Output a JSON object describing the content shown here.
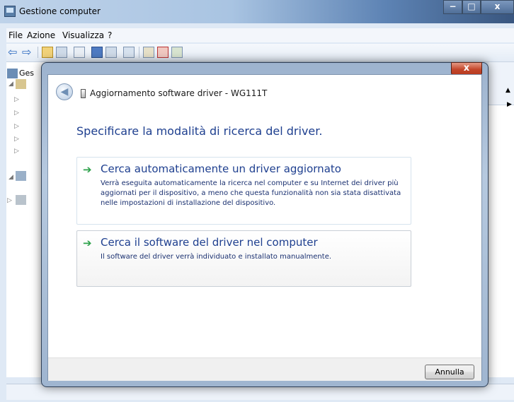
{
  "background_window": {
    "title": "Gestione computer",
    "title_icon": "computer-management-icon",
    "controls": {
      "minimize": "−",
      "maximize": "□",
      "close": "x"
    },
    "menu": [
      "File",
      "Azione",
      "Visualizza",
      "?"
    ],
    "tree_label": "Ges"
  },
  "dialog": {
    "close": "x",
    "title": "Aggiornamento software driver - WG111T",
    "heading": "Specificare la modalità di ricerca del driver.",
    "options": [
      {
        "title": "Cerca automaticamente un driver aggiornato",
        "description": "Verrà eseguita automaticamente la ricerca nel computer e su Internet dei driver più aggiornati per il dispositivo, a meno che questa funzionalità non sia stata disattivata nelle impostazioni di installazione del dispositivo.",
        "icon": "green-arrow-icon"
      },
      {
        "title": "Cerca il software del driver nel computer",
        "description": "Il software del driver verrà individuato e installato manualmente.",
        "icon": "green-arrow-icon"
      }
    ],
    "cancel_label": "Annulla"
  },
  "colors": {
    "heading": "#1e3f8f",
    "arrow": "#2da14a",
    "close_button": "#c3462a"
  }
}
